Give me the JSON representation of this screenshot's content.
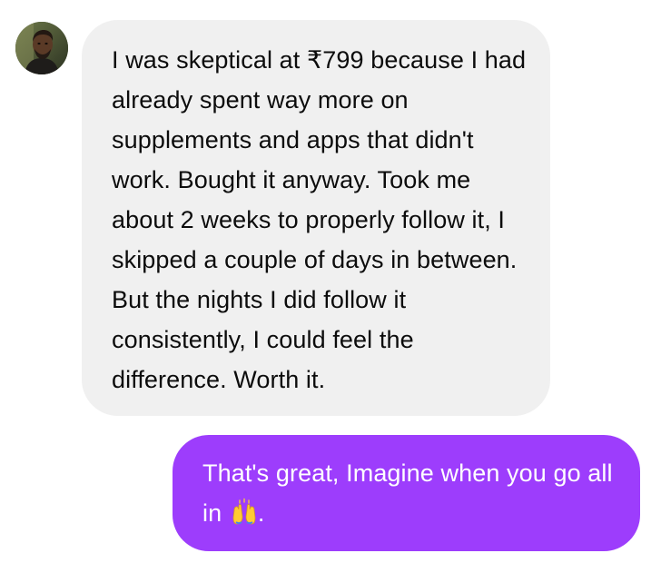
{
  "conversation": {
    "received_message": {
      "text": "I was skeptical at ₹799 because I had already spent way more on supplements and apps that didn't work. Bought it anyway. Took me about 2 weeks to properly follow it, I skipped a couple of days in between. But the nights I did follow it consistently, I could feel the difference. Worth it."
    },
    "sent_message": {
      "text": "That's great, Imagine when you go all in",
      "emoji": "raising-hands",
      "trailing": "."
    }
  },
  "colors": {
    "received_bubble": "#f0f0f0",
    "sent_bubble": "#9d3dfc",
    "sent_text": "#ffffff",
    "received_text": "#0c0c0c"
  }
}
